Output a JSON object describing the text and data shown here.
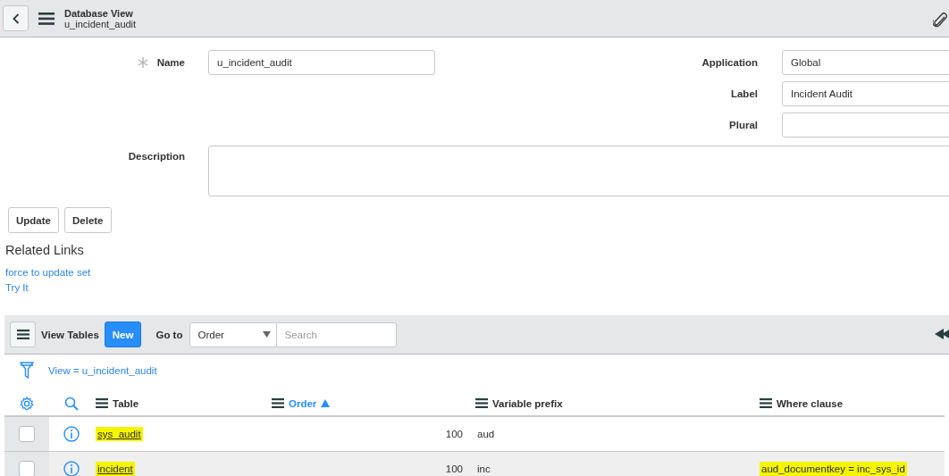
{
  "header": {
    "title": "Database View",
    "subtitle": "u_incident_audit"
  },
  "form": {
    "rows": [
      {
        "label": "Name",
        "value": "u_incident_audit",
        "required": true,
        "side_label": "Application",
        "side_value": "Global"
      },
      {
        "side_label": "Label",
        "side_value": "Incident Audit"
      },
      {
        "side_label": "Plural"
      }
    ],
    "description": {
      "label": "Description"
    }
  },
  "buttons": [
    "Update",
    "Delete"
  ],
  "related_links": {
    "title": "Related Links",
    "links": [
      "force to update set",
      "Try It"
    ]
  },
  "list": {
    "title": "View Tables",
    "new_button": "New",
    "goto_label": "Go to",
    "goto_field": "Order",
    "search": {
      "placeholder": "Search"
    },
    "filter": "View = u_incident_audit",
    "columns": [
      {
        "label": "Table",
        "kind": "link",
        "sorted": false
      },
      {
        "label": "Order",
        "kind": "number",
        "sorted": true
      },
      {
        "label": "Variable prefix",
        "kind": "text",
        "sorted": false
      },
      {
        "label": "Where clause",
        "kind": "text",
        "sorted": false
      }
    ],
    "rows": [
      {
        "checked": false,
        "cells": [
          {
            "text": "sys_audit",
            "highlighted": true
          },
          {
            "text": "100",
            "highlighted": false
          },
          {
            "text": "aud",
            "highlighted": false
          }
        ]
      },
      {
        "checked": false,
        "cells": [
          {
            "text": "incident",
            "highlighted": true
          },
          {
            "text": "100",
            "highlighted": false
          },
          {
            "text": "inc",
            "highlighted": false
          },
          {
            "text": "aud_documentkey = inc_sys_id",
            "highlighted": true
          }
        ]
      }
    ]
  }
}
